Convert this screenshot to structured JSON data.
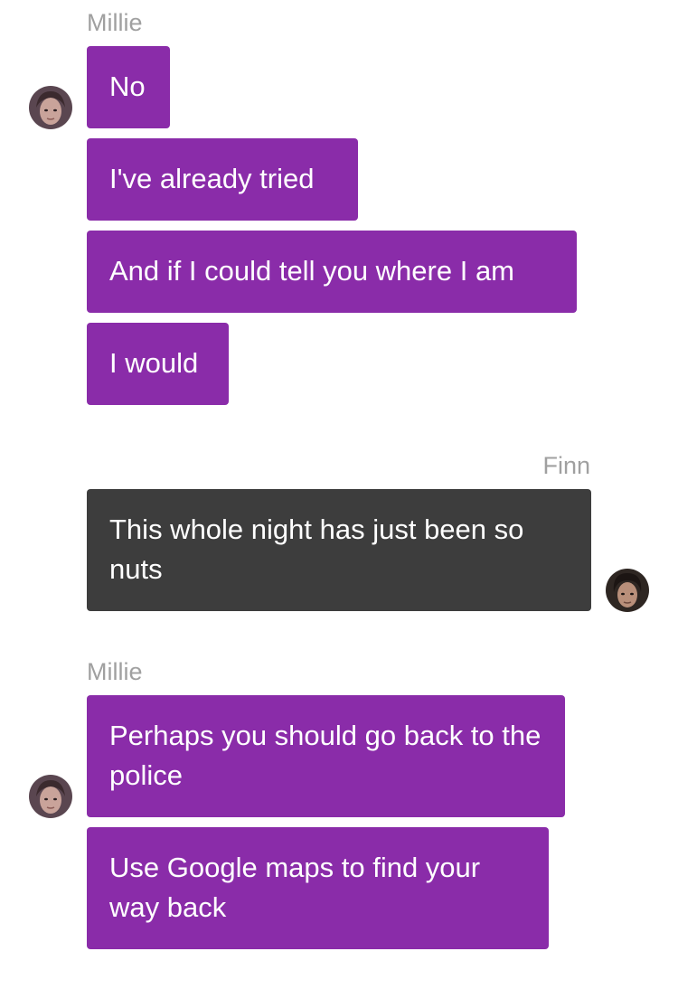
{
  "colors": {
    "millie_bubble": "#8a2ca9",
    "finn_bubble": "#3d3d3d",
    "sender_name": "#a0a0a0",
    "bubble_text": "#ffffff"
  },
  "groups": [
    {
      "sender": "Millie",
      "avatar_icon": "millie-avatar-icon",
      "messages": [
        "No",
        "I've already tried",
        "And if I could tell you where I am",
        "I would"
      ]
    },
    {
      "sender": "Finn",
      "avatar_icon": "finn-avatar-icon",
      "messages": [
        "This whole night has just been so nuts"
      ]
    },
    {
      "sender": "Millie",
      "avatar_icon": "millie-avatar-icon",
      "messages": [
        "Perhaps you should go back to the police",
        "Use Google maps to find your way back"
      ]
    }
  ]
}
